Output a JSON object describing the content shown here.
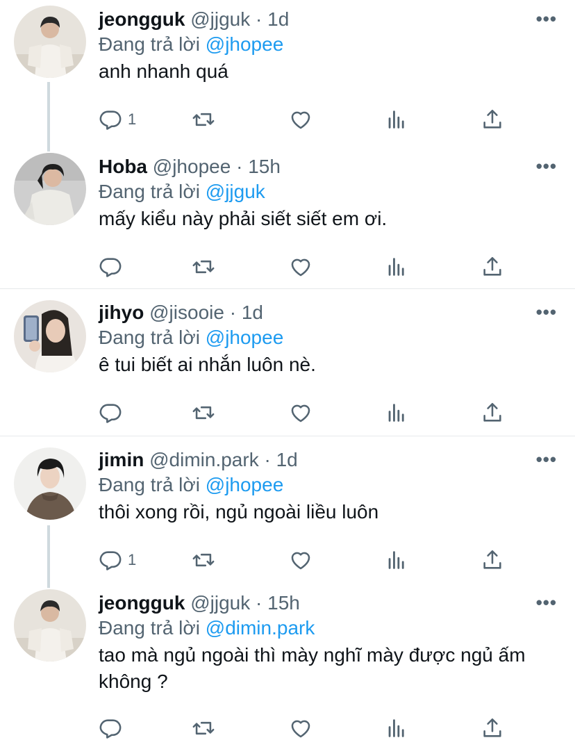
{
  "replying_label": "Đang trả lời",
  "colors": {
    "link": "#1d9bf0",
    "secondary": "#536471",
    "text": "#0f1419"
  },
  "tweets": [
    {
      "name": "jeongguk",
      "handle": "@jjguk",
      "dot": "·",
      "time": "1d",
      "replying_to": "@jhopee",
      "text": "anh nhanh quá",
      "reply_count": "1",
      "more": "•••"
    },
    {
      "name": "Hoba",
      "handle": "@jhopee",
      "dot": "·",
      "time": "15h",
      "replying_to": "@jjguk",
      "text": "mấy kiểu này phải siết siết em ơi.",
      "reply_count": "",
      "more": "•••"
    },
    {
      "name": "jihyo",
      "handle": "@jisooie",
      "dot": "·",
      "time": "1d",
      "replying_to": "@jhopee",
      "text": "ê tui biết ai nhắn luôn nè.",
      "reply_count": "",
      "more": "•••"
    },
    {
      "name": "jimin",
      "handle": "@dimin.park",
      "dot": "·",
      "time": "1d",
      "replying_to": "@jhopee",
      "text": "thôi xong rồi, ngủ ngoài liều luôn",
      "reply_count": "1",
      "more": "•••"
    },
    {
      "name": "jeongguk",
      "handle": "@jjguk",
      "dot": "·",
      "time": "15h",
      "replying_to": "@dimin.park",
      "text": "tao mà ngủ ngoài thì mày nghĩ mày được ngủ ấm không ?",
      "reply_count": "",
      "more": "•••"
    }
  ]
}
